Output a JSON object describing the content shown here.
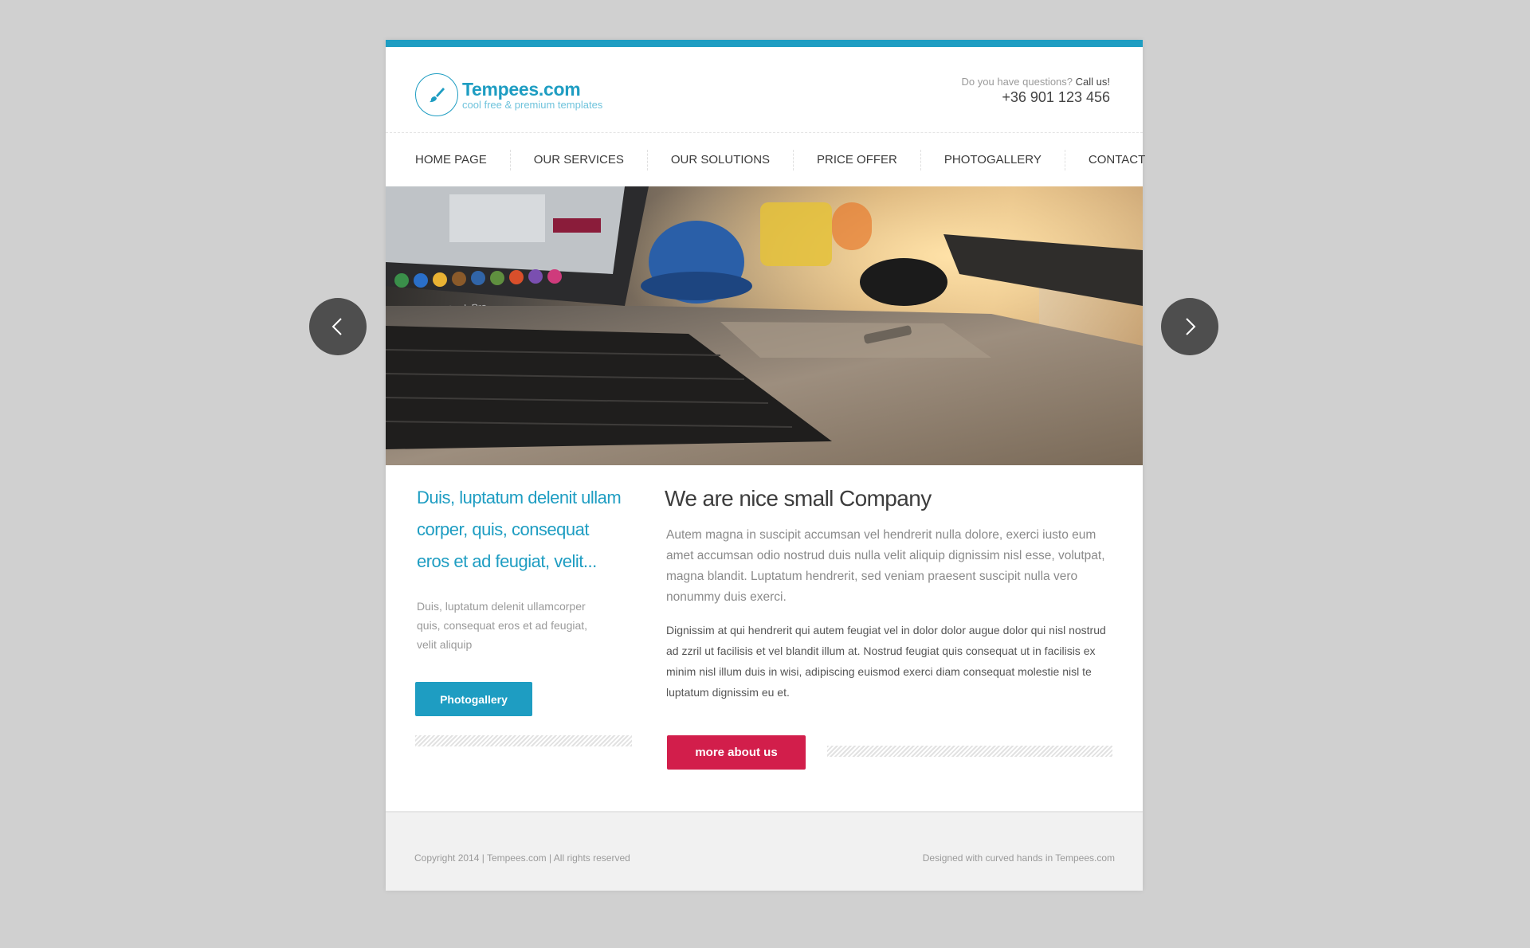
{
  "brand": {
    "name": "Tempees.com",
    "tagline": "cool free & premium templates",
    "logo_icon": "brush-icon",
    "accent_color": "#1e9dc2"
  },
  "contact": {
    "question": "Do you have questions?",
    "call": "Call us!",
    "phone": "+36 901 123 456"
  },
  "nav": {
    "items": [
      {
        "label": "HOME PAGE"
      },
      {
        "label": "OUR SERVICES"
      },
      {
        "label": "OUR SOLUTIONS"
      },
      {
        "label": "PRICE OFFER"
      },
      {
        "label": "PHOTOGALLERY"
      },
      {
        "label": "CONTACT"
      }
    ]
  },
  "slider": {
    "prev_icon": "chevron-left-icon",
    "next_icon": "chevron-right-icon",
    "laptop_label": "MacBook Pro"
  },
  "intro": {
    "lead": "Duis, luptatum delenit ullam corper, quis, consequat eros et ad feugiat, velit...",
    "text": "Duis, luptatum delenit ullamcorper quis, consequat eros et ad feugiat, velit aliquip",
    "button": "Photogallery"
  },
  "about": {
    "heading": "We are nice small Company",
    "para1": "Autem magna in suscipit accumsan vel hendrerit nulla dolore, exerci iusto eum amet accumsan odio nostrud duis nulla velit aliquip dignissim nisl esse, volutpat, magna blandit. Luptatum hendrerit, sed veniam praesent suscipit nulla vero nonummy duis exerci.",
    "para2": "Dignissim at qui hendrerit qui autem feugiat vel in dolor dolor augue dolor qui nisl nostrud ad zzril ut facilisis et vel blandit illum at. Nostrud feugiat quis consequat ut in facilisis ex minim nisl illum duis in wisi, adipiscing euismod exerci diam consequat molestie nisl te luptatum dignissim eu et.",
    "button": "more about us",
    "button_color": "#d21e4b"
  },
  "footer": {
    "copyright": "Copyright 2014 | Tempees.com | All rights reserved",
    "credit": "Designed with curved hands in Tempees.com"
  }
}
